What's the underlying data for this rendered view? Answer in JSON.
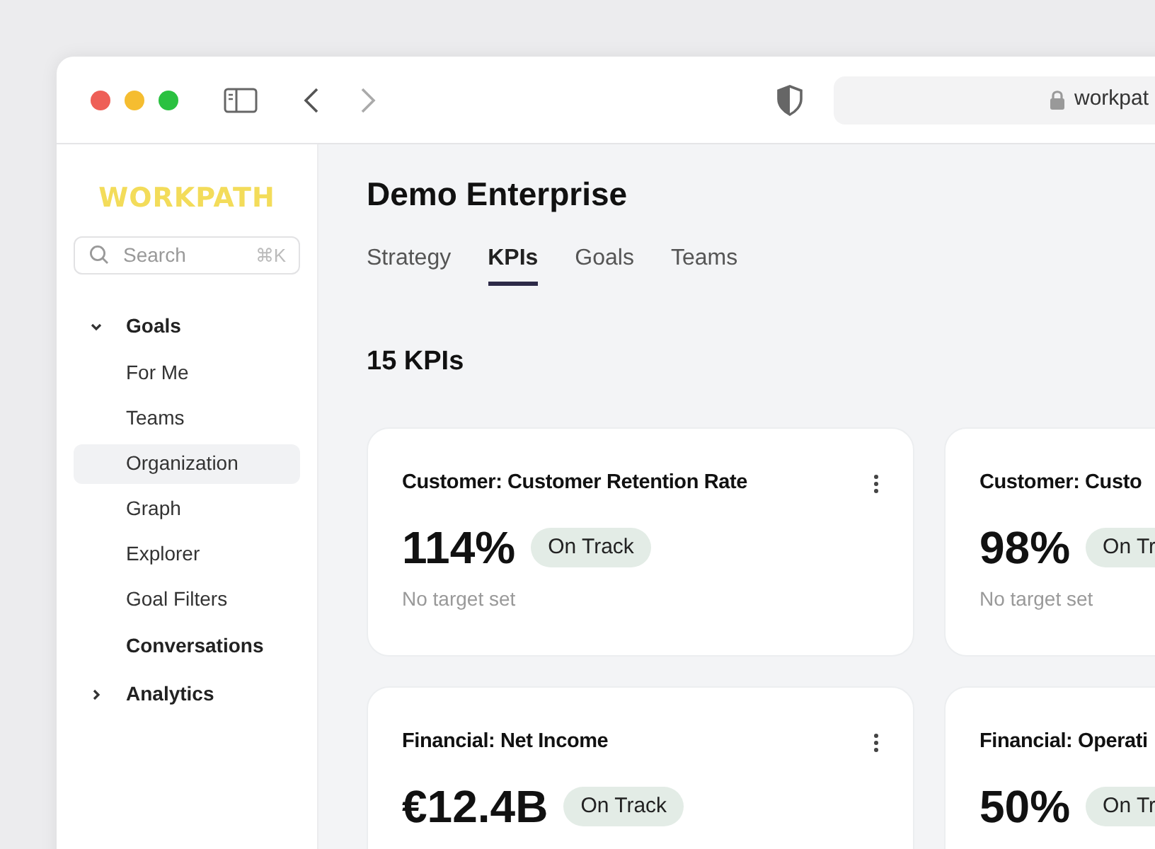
{
  "browser": {
    "url": "workpat"
  },
  "sidebar": {
    "logo": "WORKPATH",
    "search": {
      "placeholder": "Search",
      "shortcut": "⌘K"
    },
    "items": [
      {
        "label": "Goals",
        "expanded": true,
        "children": [
          {
            "label": "For Me",
            "selected": false
          },
          {
            "label": "Teams",
            "selected": false
          },
          {
            "label": "Organization",
            "selected": true
          },
          {
            "label": "Graph",
            "selected": false
          },
          {
            "label": "Explorer",
            "selected": false
          },
          {
            "label": "Goal Filters",
            "selected": false
          }
        ]
      },
      {
        "label": "Conversations"
      },
      {
        "label": "Analytics",
        "expanded": false
      }
    ]
  },
  "page": {
    "title": "Demo Enterprise",
    "tabs": [
      {
        "label": "Strategy",
        "selected": false
      },
      {
        "label": "KPIs",
        "selected": true
      },
      {
        "label": "Goals",
        "selected": false
      },
      {
        "label": "Teams",
        "selected": false
      }
    ],
    "count": "15 KPIs",
    "cards": [
      {
        "title": "Customer: Customer Retention Rate",
        "value": "114%",
        "status": "On Track",
        "note": "No target set"
      },
      {
        "title": "Customer: Custo",
        "value": "98%",
        "status": "On Tr",
        "note": "No target set"
      },
      {
        "title": "Financial: Net Income",
        "value": "€12.4B",
        "status": "On Track"
      },
      {
        "title": "Financial: Operati",
        "value": "50%",
        "status": "On Tr"
      }
    ]
  }
}
